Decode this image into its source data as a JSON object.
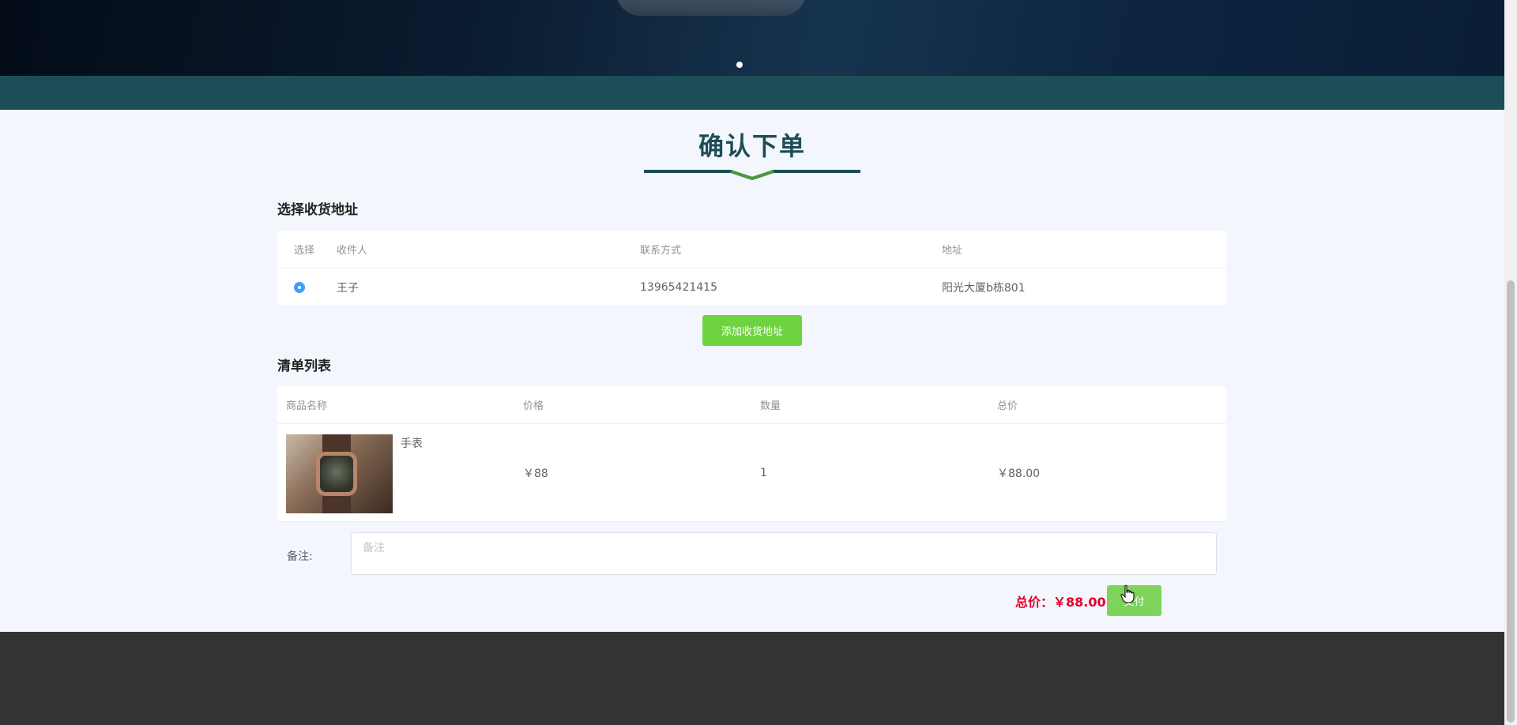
{
  "page": {
    "title": "确认下单"
  },
  "address_section": {
    "heading": "选择收货地址",
    "columns": [
      "选择",
      "收件人",
      "联系方式",
      "地址"
    ],
    "rows": [
      {
        "recipient": "王子",
        "phone": "13965421415",
        "address": "阳光大厦b栋801",
        "selected": true
      }
    ],
    "add_button": "添加收货地址"
  },
  "order_section": {
    "heading": "清单列表",
    "columns": [
      "商品名称",
      "价格",
      "数量",
      "总价"
    ],
    "rows": [
      {
        "name": "手表",
        "price": "￥88",
        "quantity": "1",
        "total": "￥88.00"
      }
    ]
  },
  "remark": {
    "label": "备注:",
    "placeholder": "备注"
  },
  "summary": {
    "total_label": "总价：￥88.00",
    "pay_button": "支付"
  },
  "colors": {
    "accent_green": "#6ed33f",
    "title_color": "#1d4d56",
    "total_red": "#e3002b",
    "radio_blue": "#409eff"
  }
}
